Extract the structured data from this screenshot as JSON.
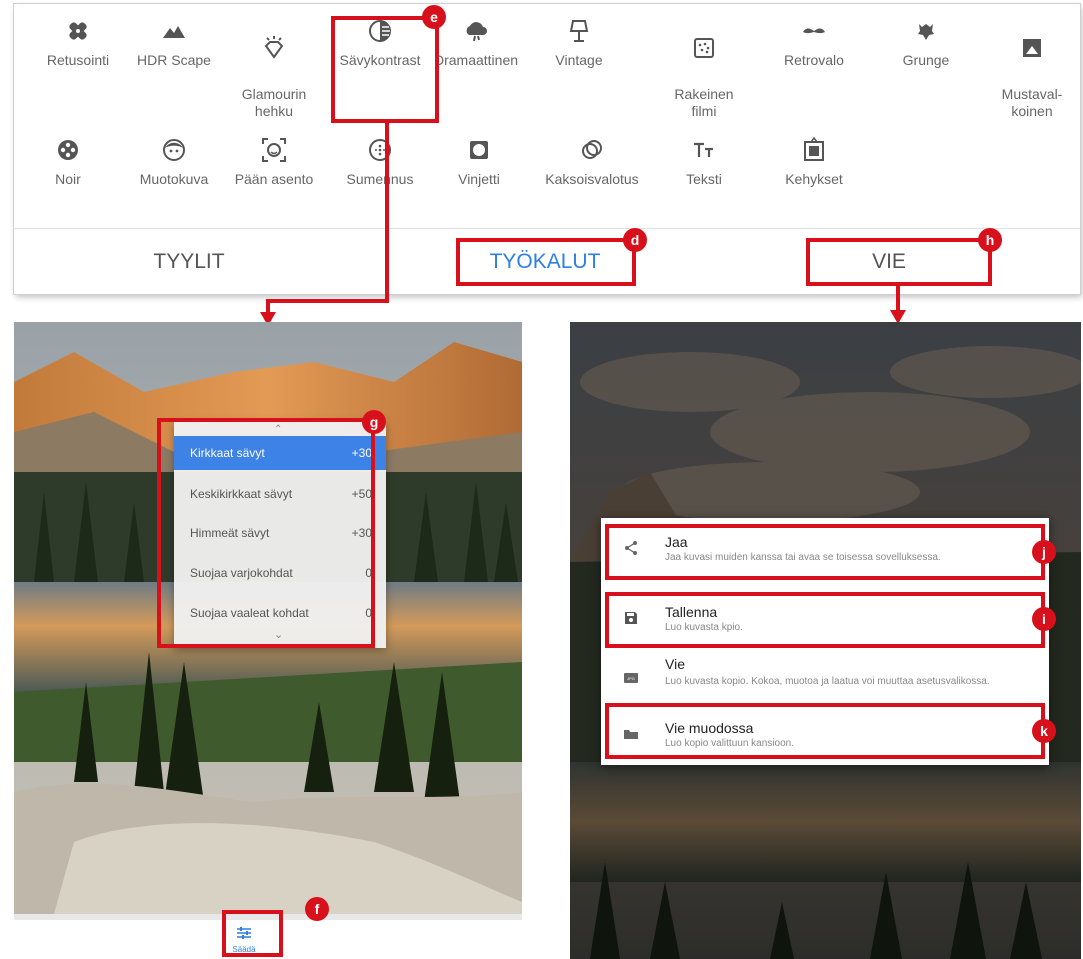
{
  "tools": {
    "row1": [
      {
        "label": "Retusointi",
        "icon": "bandage-icon"
      },
      {
        "label": "HDR Scape",
        "icon": "mountains-icon"
      },
      {
        "label": "Glamourin\nhehku",
        "icon": "glow-diamond-icon"
      },
      {
        "label": "Sävykontrast",
        "icon": "tonal-contrast-icon"
      },
      {
        "label": "Dramaattinen",
        "icon": "cloud-icon"
      },
      {
        "label": "Vintage",
        "icon": "lamp-icon"
      },
      {
        "label": "Rakeinen\nfilmi",
        "icon": "grain-icon"
      },
      {
        "label": "Retrovalo",
        "icon": "mustache-icon"
      },
      {
        "label": "Grunge",
        "icon": "guitar-icon"
      },
      {
        "label": "Mustaval-\nkoinen",
        "icon": "black-white-icon"
      }
    ],
    "row2": [
      {
        "label": "Noir",
        "icon": "film-reel-icon"
      },
      {
        "label": "Muotokuva",
        "icon": "face-icon"
      },
      {
        "label": "Pään asento",
        "icon": "face-pose-icon"
      },
      {
        "label": "Sumennus",
        "icon": "blur-icon"
      },
      {
        "label": "Vinjetti",
        "icon": "vignette-icon"
      },
      {
        "label": "Kaksoisvalotus",
        "icon": "double-exposure-icon"
      },
      {
        "label": "Teksti",
        "icon": "text-icon"
      },
      {
        "label": "Kehykset",
        "icon": "frame-icon"
      }
    ]
  },
  "tabs": {
    "styles": "TYYLIT",
    "tools": "TYÖKALUT",
    "export": "VIE"
  },
  "markers": {
    "e": "e",
    "d": "d",
    "h": "h",
    "g": "g",
    "f": "f",
    "j": "j",
    "i": "i",
    "k": "k"
  },
  "tone_menu": {
    "rows": [
      {
        "name": "Kirkkaat sävyt",
        "value": "+30",
        "selected": true
      },
      {
        "name": "Keskikirkkaat sävyt",
        "value": "+50"
      },
      {
        "name": "Himmeät sävyt",
        "value": "+30"
      },
      {
        "name": "Suojaa varjokohdat",
        "value": "0"
      },
      {
        "name": "Suojaa vaaleat kohdat",
        "value": "0"
      }
    ]
  },
  "adjust_button": {
    "label": "Säädä",
    "icon": "sliders-icon"
  },
  "export_menu": {
    "items": [
      {
        "title": "Jaa",
        "subtitle": "Jaa kuvasi muiden kanssa tai avaa se toisessa sovelluksessa.",
        "icon": "share-icon"
      },
      {
        "title": "Tallenna",
        "subtitle": "Luo kuvasta kpio.",
        "icon": "save-icon"
      },
      {
        "title": "Vie",
        "subtitle": "Luo kuvasta kopio. Kokoa, muotoa ja laatua voi muuttaa asetusvalikossa.",
        "icon": "jpg-icon"
      },
      {
        "title": "Vie muodossa",
        "subtitle": "Luo kopio valittuun kansioon.",
        "icon": "folder-icon"
      }
    ]
  },
  "colors": {
    "accent": "#2f7fe0",
    "highlight": "#d8101c",
    "selection": "#3d82e6"
  }
}
